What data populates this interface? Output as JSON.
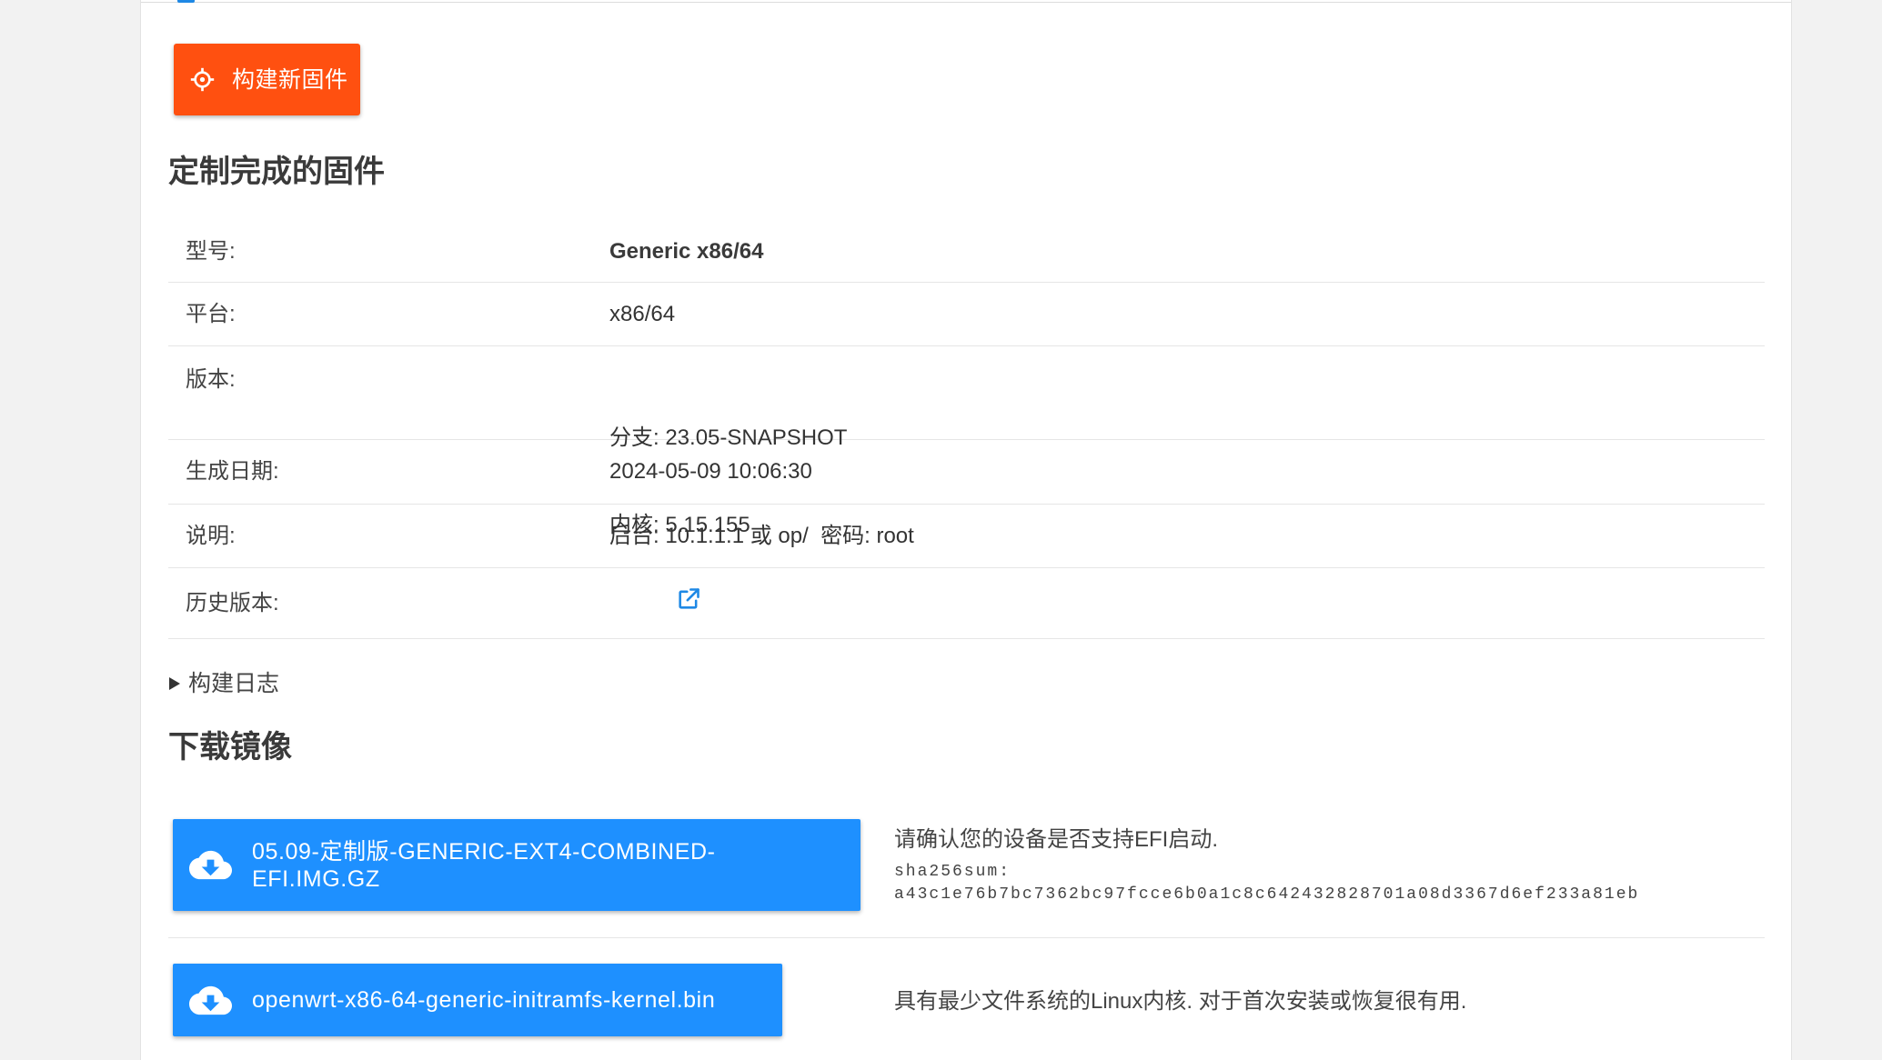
{
  "colors": {
    "page_background": "#f2f2f2",
    "build_button": "#ff5010",
    "download_button": "#1e90ff",
    "link": "#1e88e5"
  },
  "build_button": {
    "label": "构建新固件",
    "icon": "gear-icon"
  },
  "firmware": {
    "title": "定制完成的固件",
    "rows": [
      {
        "label": "型号:",
        "value": "Generic x86/64"
      },
      {
        "label": "平台:",
        "value": "x86/64"
      },
      {
        "label": "版本:",
        "lines": [
          "分支: 23.05-SNAPSHOT",
          "内核: 5.15.155"
        ]
      },
      {
        "label": "生成日期:",
        "value": "2024-05-09 10:06:30"
      },
      {
        "label": "说明:",
        "value": "后台: 10.1.1.1 或 op/  密码: root"
      },
      {
        "label": "历史版本:",
        "icon": "external-link-icon"
      }
    ]
  },
  "build_log": {
    "label": "构建日志"
  },
  "downloads": {
    "title": "下载镜像",
    "items": [
      {
        "label": "05.09-定制版-GENERIC-EXT4-COMBINED-EFI.IMG.GZ",
        "icon": "cloud-download-icon",
        "note": "请确认您的设备是否支持EFI启动.",
        "hash_label": "sha256sum:",
        "hash": "a43c1e76b7bc7362bc97fcce6b0a1c8c642432828701a08d3367d6ef233a81eb"
      },
      {
        "label": "openwrt-x86-64-generic-initramfs-kernel.bin",
        "icon": "cloud-download-icon",
        "note": "具有最少文件系统的Linux内核. 对于首次安装或恢复很有用."
      }
    ]
  }
}
